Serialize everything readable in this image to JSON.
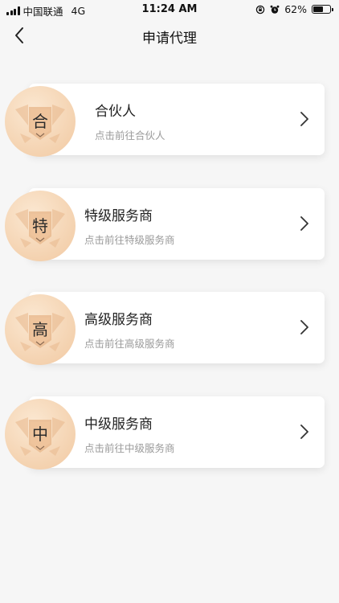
{
  "status": {
    "carrier": "中国联通",
    "network": "4G",
    "time": "11:24 AM",
    "battery": "62%",
    "battery_level": 0.62
  },
  "nav": {
    "title": "申请代理",
    "back_icon": "chevron-left-icon"
  },
  "colors": {
    "badge_outer": "#f3cfab",
    "badge_inner": "#e7b68a",
    "chevron": "#333333",
    "subtitle": "#9a9a9a"
  },
  "items": [
    {
      "badge": "合",
      "title": "合伙人",
      "subtitle": "点击前往合伙人"
    },
    {
      "badge": "特",
      "title": "特级服务商",
      "subtitle": "点击前往特级服务商"
    },
    {
      "badge": "高",
      "title": "高级服务商",
      "subtitle": "点击前往高级服务商"
    },
    {
      "badge": "中",
      "title": "中级服务商",
      "subtitle": "点击前往中级服务商"
    }
  ]
}
